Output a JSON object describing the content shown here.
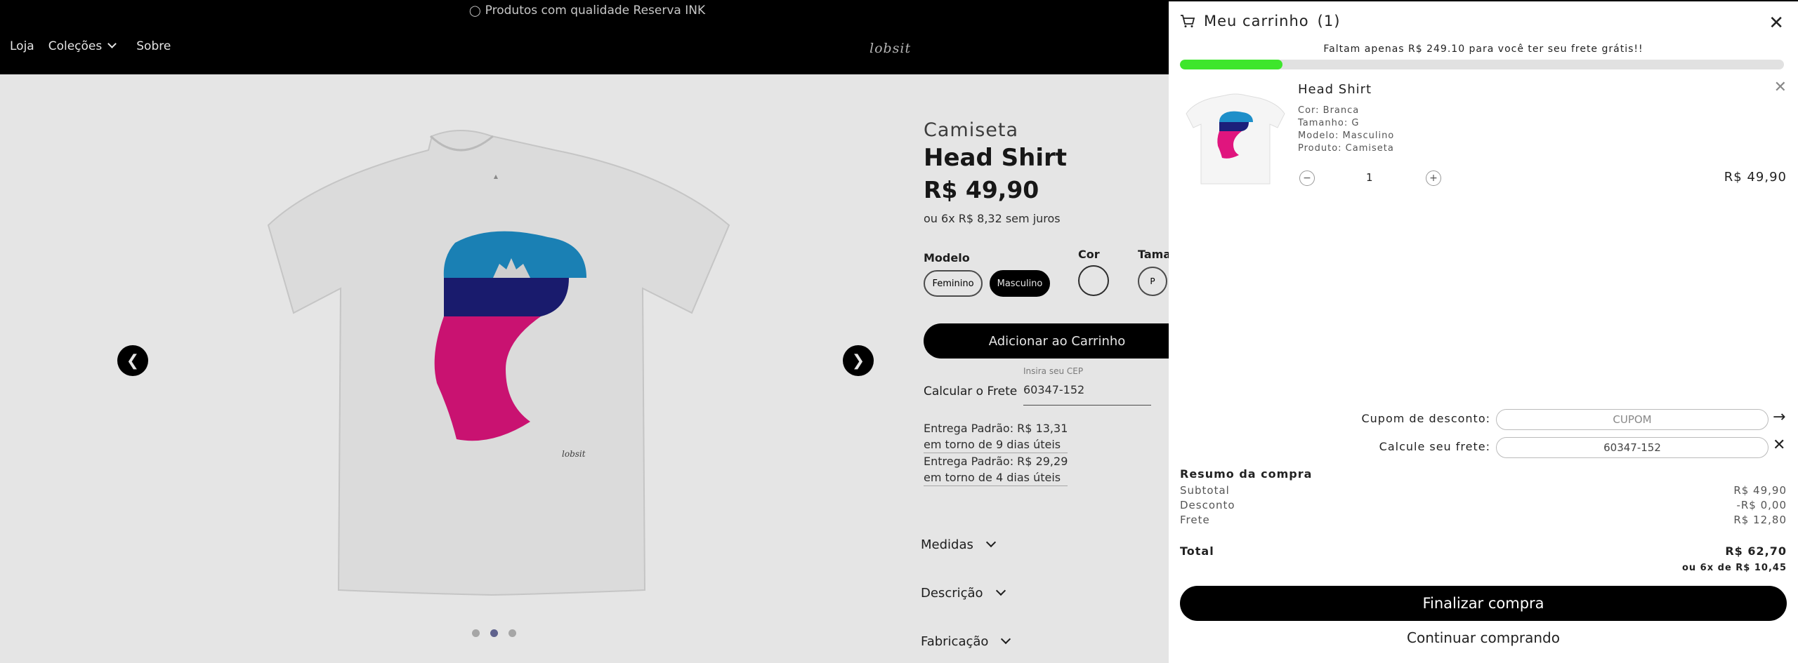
{
  "announcement": "Produtos com qualidade Reserva INK",
  "nav": {
    "items": [
      "Loja",
      "Coleções",
      "Sobre"
    ],
    "logo": "lobsit"
  },
  "product": {
    "category": "Camiseta",
    "name": "Head Shirt",
    "price": "R$ 49,90",
    "installments": "ou 6x R$ 8,32 sem juros",
    "modelo_label": "Modelo",
    "modelo_options": [
      "Feminino",
      "Masculino"
    ],
    "modelo_selected": "Masculino",
    "cor_label": "Cor",
    "tamanho_label": "Tama",
    "tamanho_first": "P",
    "add_to_cart": "Adicionar ao Carrinho",
    "frete_label": "Calcular o Frete",
    "cep_hint": "Insira seu CEP",
    "cep_value": "60347-152",
    "shipping": [
      {
        "line1": "Entrega Padrão: R$ 13,31",
        "line2": "em torno de 9 dias úteis"
      },
      {
        "line1": "Entrega Padrão: R$ 29,29",
        "line2": "em torno de 4 dias úteis"
      }
    ],
    "accordions": [
      "Medidas",
      "Descrição",
      "Fabricação"
    ],
    "carousel": {
      "slides": 3,
      "active": 1
    },
    "print_signature": "lobsit"
  },
  "cart": {
    "title": "Meu carrinho",
    "count": "(1)",
    "promo": "Faltam apenas R$ 249.10 para você ter seu frete grátis!!",
    "free_shipping_progress": 0.17,
    "item": {
      "name": "Head Shirt",
      "attrs": [
        "Cor: Branca",
        "Tamanho: G",
        "Modelo: Masculino",
        "Produto: Camiseta"
      ],
      "qty": "1",
      "price": "R$ 49,90"
    },
    "coupon_label": "Cupom de desconto:",
    "coupon_placeholder": "CUPOM",
    "freight_label": "Calcule seu frete:",
    "freight_value": "60347-152",
    "summary": {
      "title": "Resumo da compra",
      "rows": [
        {
          "label": "Subtotal",
          "value": "R$ 49,90"
        },
        {
          "label": "Desconto",
          "value": "-R$ 0,00"
        },
        {
          "label": "Frete",
          "value": "R$ 12,80"
        }
      ],
      "total_label": "Total",
      "total_value": "R$ 62,70",
      "installments": "ou 6x de R$ 10,45"
    },
    "checkout": "Finalizar compra",
    "continue": "Continuar comprando"
  },
  "colors": {
    "progress": "#3ee62c",
    "headTop": "#1e8fc9",
    "headBand": "#1c1f7a",
    "headFace": "#e0157e"
  }
}
